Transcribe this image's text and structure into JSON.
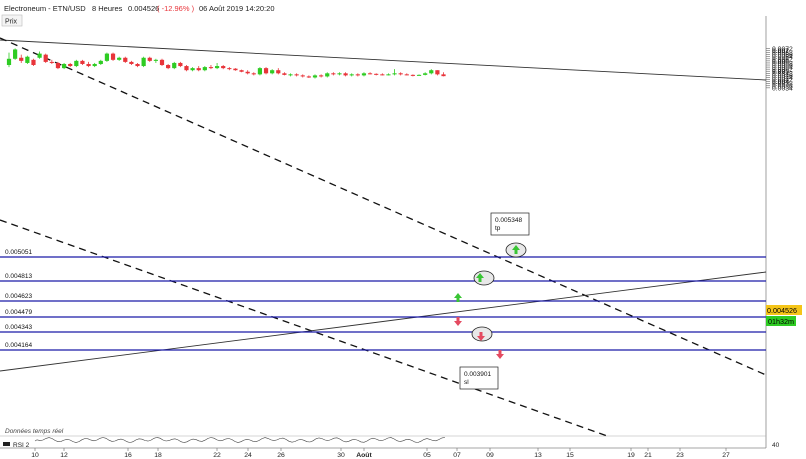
{
  "header": {
    "instrument": "Electroneum - ETN/USD",
    "timeframe": "8 Heures",
    "last_price": "0.004526",
    "change": "( -12.96% )",
    "datetime": "06 Août 2019 14:20:20"
  },
  "panel_label": "Prix",
  "footer_note": "Données temps réel",
  "rsi_label": "RSI 2",
  "rsi_axis_value": "40",
  "price_tag": {
    "value": "0.004526",
    "countdown": "01h32m"
  },
  "colors": {
    "up": "#2ecc23",
    "down": "#e8343a",
    "hline": "#1a1aa6",
    "price_tag_bg": "#f5c518",
    "countdown_bg": "#2ecc23",
    "arrow_up": "#39c534",
    "arrow_down": "#e44a60"
  },
  "chart_data": {
    "type": "candlestick",
    "y_axis": {
      "min": 0.0033,
      "max": 0.0073,
      "ticks": [
        "0.0072",
        "0.007",
        "0.0068",
        "0.0066",
        "0.0064",
        "0.0062",
        "0.006",
        "0.0058",
        "0.0056",
        "0.0054",
        "0.0052",
        "0.005",
        "0.0048",
        "0.0046",
        "0.0044",
        "0.0042",
        "0.004",
        "0.0038",
        "0.0036",
        "0.0034"
      ],
      "bold_ticks": [
        "0.007",
        "0.006",
        "0.005",
        "0.004"
      ]
    },
    "x_axis": {
      "labels": [
        "10",
        "12",
        "16",
        "18",
        "22",
        "24",
        "26",
        "30",
        "Août",
        "05",
        "07",
        "09",
        "13",
        "15",
        "19",
        "21",
        "23",
        "27"
      ]
    },
    "horizontal_levels": [
      {
        "label": "0.005051",
        "value": 0.005051
      },
      {
        "label": "0.004813",
        "value": 0.004813
      },
      {
        "label": "0.004623",
        "value": 0.004623
      },
      {
        "label": "0.004479",
        "value": 0.004479
      },
      {
        "label": "0.004343",
        "value": 0.004343
      },
      {
        "label": "0.004164",
        "value": 0.004164
      }
    ],
    "annotations": [
      {
        "label": "0.005348",
        "sublabel": "tp"
      },
      {
        "label": "0.003901",
        "sublabel": "sl"
      }
    ],
    "candles": [
      {
        "o": 0.0056,
        "h": 0.0068,
        "l": 0.0054,
        "c": 0.0062
      },
      {
        "o": 0.0062,
        "h": 0.0072,
        "l": 0.0061,
        "c": 0.0071
      },
      {
        "o": 0.0063,
        "h": 0.0066,
        "l": 0.0058,
        "c": 0.006
      },
      {
        "o": 0.0058,
        "h": 0.0065,
        "l": 0.0057,
        "c": 0.0064
      },
      {
        "o": 0.0061,
        "h": 0.0062,
        "l": 0.0055,
        "c": 0.0056
      },
      {
        "o": 0.0063,
        "h": 0.0069,
        "l": 0.0062,
        "c": 0.0067
      },
      {
        "o": 0.0066,
        "h": 0.0067,
        "l": 0.0058,
        "c": 0.0059
      },
      {
        "o": 0.0059,
        "h": 0.0061,
        "l": 0.0057,
        "c": 0.0058
      },
      {
        "o": 0.0058,
        "h": 0.0059,
        "l": 0.0052,
        "c": 0.0053
      },
      {
        "o": 0.0053,
        "h": 0.0058,
        "l": 0.0052,
        "c": 0.0057
      },
      {
        "o": 0.0057,
        "h": 0.0058,
        "l": 0.0054,
        "c": 0.0055
      },
      {
        "o": 0.0055,
        "h": 0.0061,
        "l": 0.0054,
        "c": 0.006
      },
      {
        "o": 0.006,
        "h": 0.0061,
        "l": 0.0056,
        "c": 0.0057
      },
      {
        "o": 0.0057,
        "h": 0.0059,
        "l": 0.0054,
        "c": 0.0055
      },
      {
        "o": 0.0055,
        "h": 0.0058,
        "l": 0.0054,
        "c": 0.0057
      },
      {
        "o": 0.0057,
        "h": 0.0061,
        "l": 0.0056,
        "c": 0.006
      },
      {
        "o": 0.006,
        "h": 0.0068,
        "l": 0.0059,
        "c": 0.0067
      },
      {
        "o": 0.0067,
        "h": 0.0068,
        "l": 0.006,
        "c": 0.0061
      },
      {
        "o": 0.0061,
        "h": 0.0064,
        "l": 0.006,
        "c": 0.0063
      },
      {
        "o": 0.0063,
        "h": 0.0064,
        "l": 0.0058,
        "c": 0.0059
      },
      {
        "o": 0.0059,
        "h": 0.006,
        "l": 0.0056,
        "c": 0.0057
      },
      {
        "o": 0.0057,
        "h": 0.0058,
        "l": 0.0054,
        "c": 0.0055
      },
      {
        "o": 0.0055,
        "h": 0.0064,
        "l": 0.0054,
        "c": 0.0063
      },
      {
        "o": 0.0063,
        "h": 0.0064,
        "l": 0.0059,
        "c": 0.006
      },
      {
        "o": 0.006,
        "h": 0.0062,
        "l": 0.0058,
        "c": 0.0061
      },
      {
        "o": 0.0061,
        "h": 0.0062,
        "l": 0.0055,
        "c": 0.0056
      },
      {
        "o": 0.0056,
        "h": 0.0057,
        "l": 0.0052,
        "c": 0.0053
      },
      {
        "o": 0.0053,
        "h": 0.0059,
        "l": 0.0052,
        "c": 0.0058
      },
      {
        "o": 0.0058,
        "h": 0.0059,
        "l": 0.0054,
        "c": 0.0055
      },
      {
        "o": 0.0055,
        "h": 0.0056,
        "l": 0.005,
        "c": 0.0051
      },
      {
        "o": 0.0051,
        "h": 0.0054,
        "l": 0.005,
        "c": 0.0053
      },
      {
        "o": 0.0053,
        "h": 0.0055,
        "l": 0.005,
        "c": 0.0051
      },
      {
        "o": 0.0051,
        "h": 0.0055,
        "l": 0.005,
        "c": 0.0054
      },
      {
        "o": 0.0054,
        "h": 0.0056,
        "l": 0.0052,
        "c": 0.0053
      },
      {
        "o": 0.0053,
        "h": 0.0058,
        "l": 0.0052,
        "c": 0.0055
      },
      {
        "o": 0.0055,
        "h": 0.0056,
        "l": 0.0052,
        "c": 0.0053
      },
      {
        "o": 0.0053,
        "h": 0.0054,
        "l": 0.0051,
        "c": 0.00525
      },
      {
        "o": 0.00525,
        "h": 0.0053,
        "l": 0.00505,
        "c": 0.0051
      },
      {
        "o": 0.0051,
        "h": 0.00515,
        "l": 0.0049,
        "c": 0.00495
      },
      {
        "o": 0.00495,
        "h": 0.0051,
        "l": 0.0047,
        "c": 0.0048
      },
      {
        "o": 0.0048,
        "h": 0.0049,
        "l": 0.0046,
        "c": 0.0047
      },
      {
        "o": 0.0047,
        "h": 0.0054,
        "l": 0.0046,
        "c": 0.0053
      },
      {
        "o": 0.0053,
        "h": 0.0054,
        "l": 0.0047,
        "c": 0.0048
      },
      {
        "o": 0.0048,
        "h": 0.0052,
        "l": 0.0047,
        "c": 0.0051
      },
      {
        "o": 0.0051,
        "h": 0.0053,
        "l": 0.0047,
        "c": 0.0048
      },
      {
        "o": 0.0048,
        "h": 0.0049,
        "l": 0.0046,
        "c": 0.00465
      },
      {
        "o": 0.00465,
        "h": 0.0048,
        "l": 0.0045,
        "c": 0.0047
      },
      {
        "o": 0.0047,
        "h": 0.0048,
        "l": 0.0045,
        "c": 0.0046
      },
      {
        "o": 0.0046,
        "h": 0.0047,
        "l": 0.0044,
        "c": 0.0045
      },
      {
        "o": 0.0045,
        "h": 0.0046,
        "l": 0.00435,
        "c": 0.0044
      },
      {
        "o": 0.0044,
        "h": 0.0047,
        "l": 0.0043,
        "c": 0.0046
      },
      {
        "o": 0.0046,
        "h": 0.0047,
        "l": 0.0044,
        "c": 0.0045
      },
      {
        "o": 0.0045,
        "h": 0.0049,
        "l": 0.0044,
        "c": 0.0048
      },
      {
        "o": 0.0048,
        "h": 0.0049,
        "l": 0.0046,
        "c": 0.0047
      },
      {
        "o": 0.0047,
        "h": 0.0049,
        "l": 0.0046,
        "c": 0.0048
      },
      {
        "o": 0.0048,
        "h": 0.0049,
        "l": 0.0045,
        "c": 0.0046
      },
      {
        "o": 0.0046,
        "h": 0.0048,
        "l": 0.0045,
        "c": 0.0047
      },
      {
        "o": 0.0047,
        "h": 0.0048,
        "l": 0.0045,
        "c": 0.0046
      },
      {
        "o": 0.0046,
        "h": 0.0049,
        "l": 0.0045,
        "c": 0.0048
      },
      {
        "o": 0.0048,
        "h": 0.0049,
        "l": 0.0047,
        "c": 0.00475
      },
      {
        "o": 0.00475,
        "h": 0.0048,
        "l": 0.0046,
        "c": 0.0047
      },
      {
        "o": 0.0047,
        "h": 0.0048,
        "l": 0.0046,
        "c": 0.00465
      },
      {
        "o": 0.00465,
        "h": 0.0048,
        "l": 0.0046,
        "c": 0.0047
      },
      {
        "o": 0.0047,
        "h": 0.0052,
        "l": 0.0046,
        "c": 0.0048
      },
      {
        "o": 0.0048,
        "h": 0.0049,
        "l": 0.0046,
        "c": 0.0047
      },
      {
        "o": 0.0047,
        "h": 0.0048,
        "l": 0.0046,
        "c": 0.00465
      },
      {
        "o": 0.00465,
        "h": 0.0047,
        "l": 0.0045,
        "c": 0.0046
      },
      {
        "o": 0.0046,
        "h": 0.0047,
        "l": 0.0046,
        "c": 0.00465
      },
      {
        "o": 0.00465,
        "h": 0.0049,
        "l": 0.0046,
        "c": 0.0048
      },
      {
        "o": 0.0048,
        "h": 0.0052,
        "l": 0.0047,
        "c": 0.0051
      },
      {
        "o": 0.0051,
        "h": 0.0051,
        "l": 0.0046,
        "c": 0.0047
      },
      {
        "o": 0.0047,
        "h": 0.0049,
        "l": 0.0045,
        "c": 0.004526
      }
    ]
  }
}
